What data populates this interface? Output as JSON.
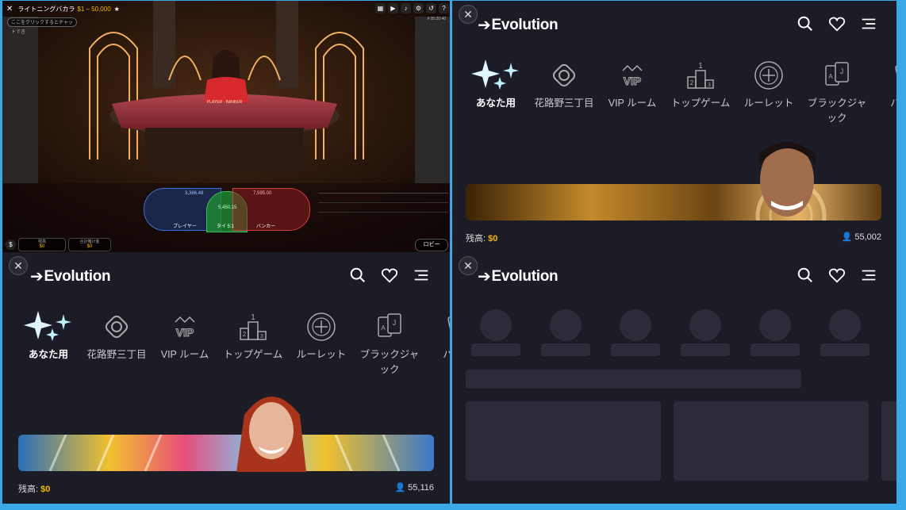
{
  "game": {
    "title": "ライトニングバカラ",
    "limits": "$1 – 50,000",
    "chat_placeholder": "ここをクリックするとチャットでき",
    "timestamp": "# 05:20:40",
    "bet_player_label": "プレイヤー",
    "bet_tie_label": "タイ 5:1",
    "bet_banker_label": "バンカー",
    "player_amount": "3,386.48",
    "banker_amount": "7,595.00",
    "tie_amount": "5,450.15",
    "balance_label": "残高",
    "balance_value": "$0",
    "total_bet_label": "合計賭け金",
    "total_bet_value": "$0",
    "lobby_label": "ロビー"
  },
  "lobby": {
    "logo_text": "Evolution",
    "categories": [
      {
        "label": "あなた用",
        "icon": "sparkles-icon"
      },
      {
        "label": "花路野三丁目",
        "icon": "lifebuoy-icon"
      },
      {
        "label": "VIP ルーム",
        "icon": "vip-crown-icon"
      },
      {
        "label": "トップゲーム",
        "icon": "podium-icon"
      },
      {
        "label": "ルーレット",
        "icon": "roulette-icon"
      },
      {
        "label": "ブラックジャック",
        "icon": "cards-icon"
      },
      {
        "label": "バカラ",
        "icon": "baccarat-cards-icon"
      }
    ],
    "balance_label": "残高: ",
    "balance_value": "$0"
  },
  "panel_top_right": {
    "players": "55,002"
  },
  "panel_bottom_left": {
    "players": "55,116"
  },
  "colors": {
    "accent_gold": "#f5b800",
    "panel_bg": "#1c1c26",
    "desktop_blue": "#3aa7e6"
  }
}
